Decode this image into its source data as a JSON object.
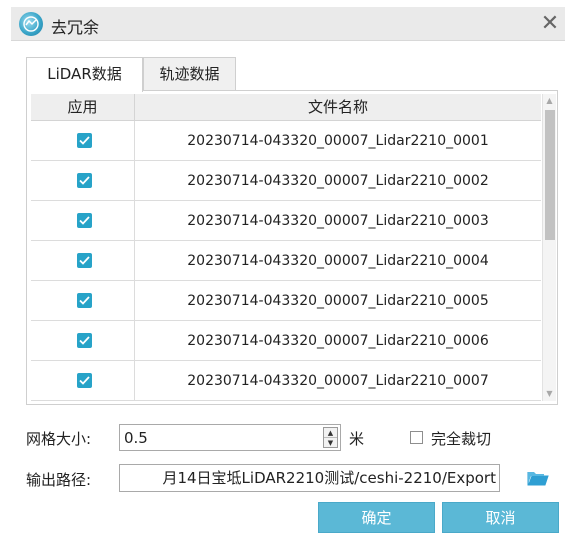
{
  "window": {
    "title": "去冗余",
    "close_glyph": "✕"
  },
  "tabs": [
    {
      "label": "LiDAR数据",
      "active": true
    },
    {
      "label": "轨迹数据",
      "active": false
    }
  ],
  "table": {
    "columns": [
      "应用",
      "文件名称"
    ],
    "rows": [
      {
        "checked": true,
        "name": "20230714-043320_00007_Lidar2210_0001"
      },
      {
        "checked": true,
        "name": "20230714-043320_00007_Lidar2210_0002"
      },
      {
        "checked": true,
        "name": "20230714-043320_00007_Lidar2210_0003"
      },
      {
        "checked": true,
        "name": "20230714-043320_00007_Lidar2210_0004"
      },
      {
        "checked": true,
        "name": "20230714-043320_00007_Lidar2210_0005"
      },
      {
        "checked": true,
        "name": "20230714-043320_00007_Lidar2210_0006"
      },
      {
        "checked": true,
        "name": "20230714-043320_00007_Lidar2210_0007"
      }
    ]
  },
  "grid_size": {
    "label": "网格大小:",
    "value": "0.5",
    "unit": "米"
  },
  "full_crop": {
    "label": "完全裁切",
    "checked": false
  },
  "output": {
    "label": "输出路径:",
    "path": "月14日宝坻LiDAR2210测试/ceshi-2210/Export"
  },
  "buttons": {
    "ok": "确定",
    "cancel": "取消"
  },
  "icons": {
    "app": "app-logo-icon",
    "folder": "folder-icon",
    "close": "close-icon"
  },
  "colors": {
    "accent": "#5bb8d6",
    "checkbox": "#27a3c8"
  }
}
